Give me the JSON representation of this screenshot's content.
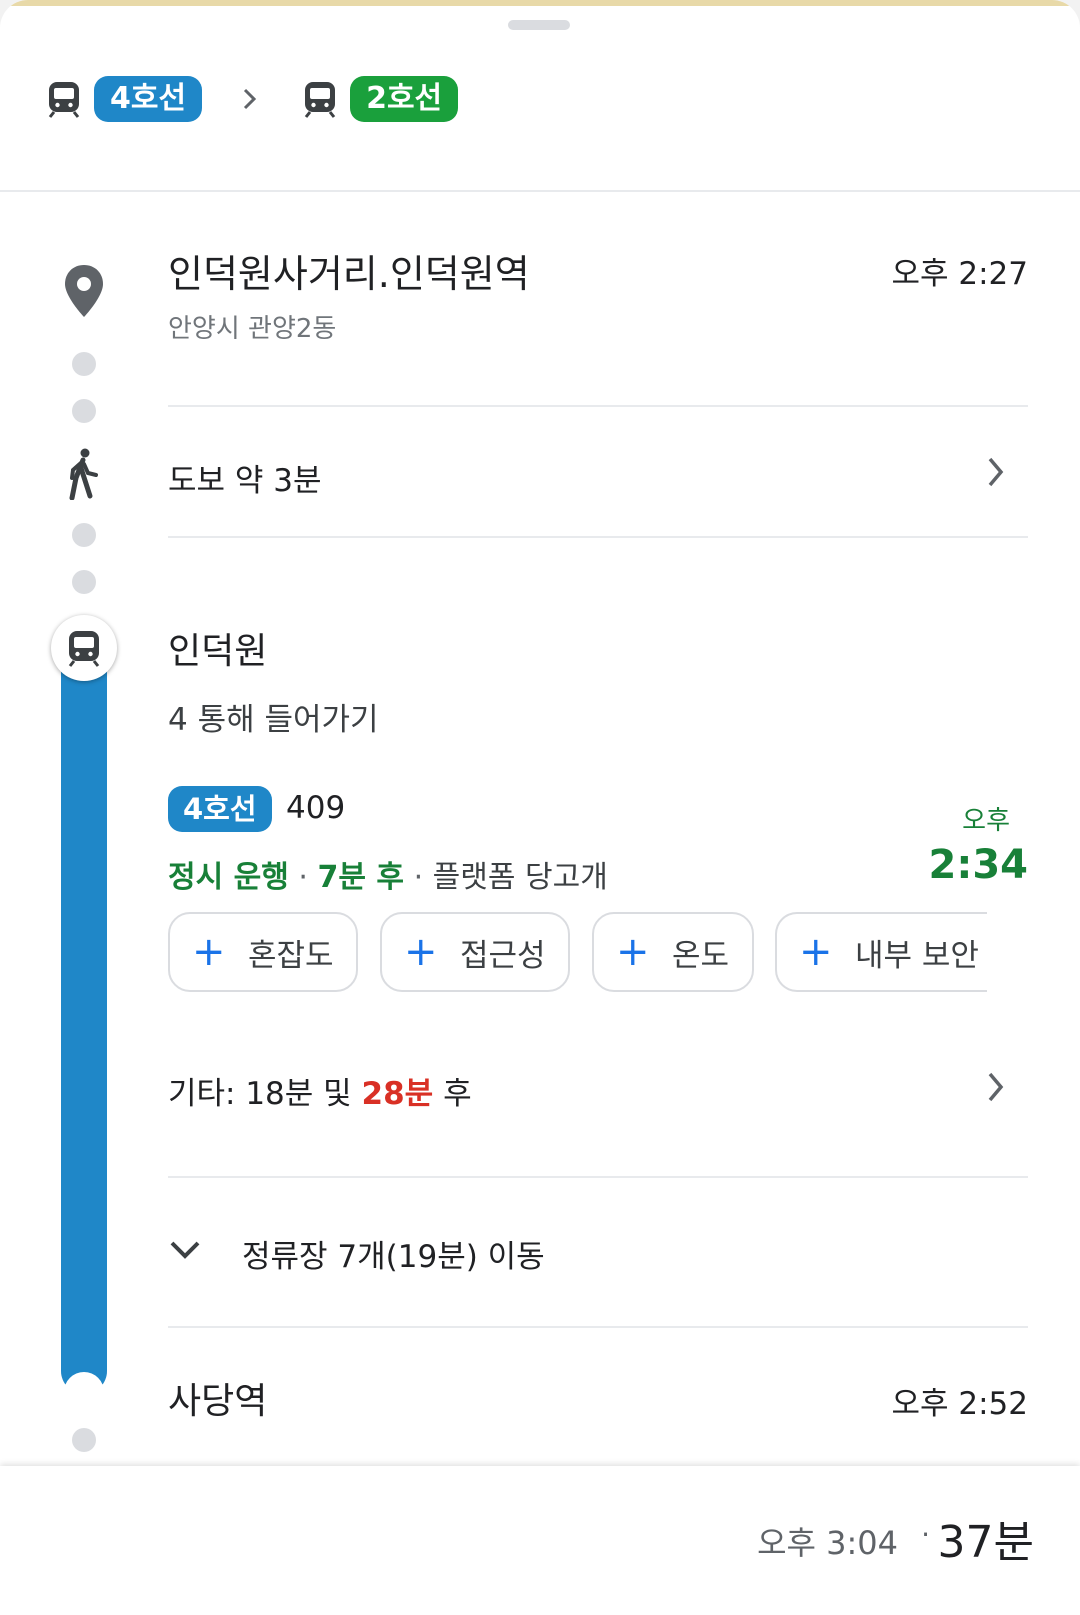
{
  "summary": {
    "legs": [
      {
        "line": "4호선",
        "color": "#1f87c8"
      },
      {
        "line": "2호선",
        "color": "#1aa03c"
      }
    ]
  },
  "origin": {
    "name": "인덕원사거리.인덕원역",
    "address": "안양시 관양2동",
    "time": "오후 2:27"
  },
  "walk": {
    "label": "도보 약 3분"
  },
  "board": {
    "station": "인덕원",
    "exit": "4 통해 들어가기",
    "line_badge": "4호선",
    "train_no": "409",
    "status": "정시 운행",
    "dot1": "·",
    "eta": "7분 후",
    "dot2": "·",
    "platform_tip": "플랫폼 당고개",
    "depart_ampm": "오후",
    "depart_time": "2:34",
    "chips": [
      {
        "plus": "+",
        "label": "혼잡도"
      },
      {
        "plus": "+",
        "label": "접근성"
      },
      {
        "plus": "+",
        "label": "온도"
      },
      {
        "plus": "+",
        "label": "내부 보안"
      }
    ],
    "other_prefix": "기타: 18분 및 ",
    "other_highlight": "28분",
    "other_suffix": " 후",
    "stops_label": "정류장 7개(19분) 이동"
  },
  "alight": {
    "station": "사당역",
    "time": "오후 2:52"
  },
  "footer": {
    "arrival": "오후 3:04",
    "dot": "·",
    "duration": "37분"
  },
  "colors": {
    "line4": "#1f87c8",
    "line2": "#1aa03c",
    "on_time": "#188038",
    "delay_red": "#d93025",
    "accent_blue": "#1a73e8"
  },
  "icons": [
    "train-icon",
    "chevron-right-icon",
    "location-pin-icon",
    "walk-icon",
    "chevron-down-icon",
    "plus-icon"
  ]
}
